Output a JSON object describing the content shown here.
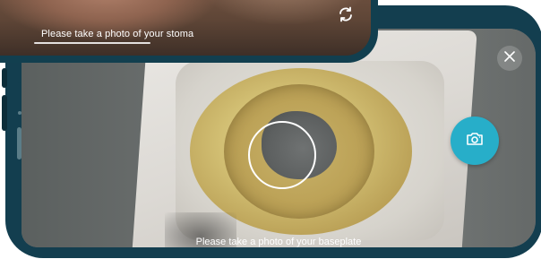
{
  "back_screen": {
    "instruction": "Please take a photo of your stoma",
    "flip_icon": "camera-flip-icon"
  },
  "front_screen": {
    "instruction": "Please take a photo of your baseplate",
    "close_icon": "close-icon",
    "capture_icon": "camera-icon"
  },
  "colors": {
    "frame": "#133e4f",
    "capture_button": "#27aec9",
    "text": "#ffffff"
  }
}
